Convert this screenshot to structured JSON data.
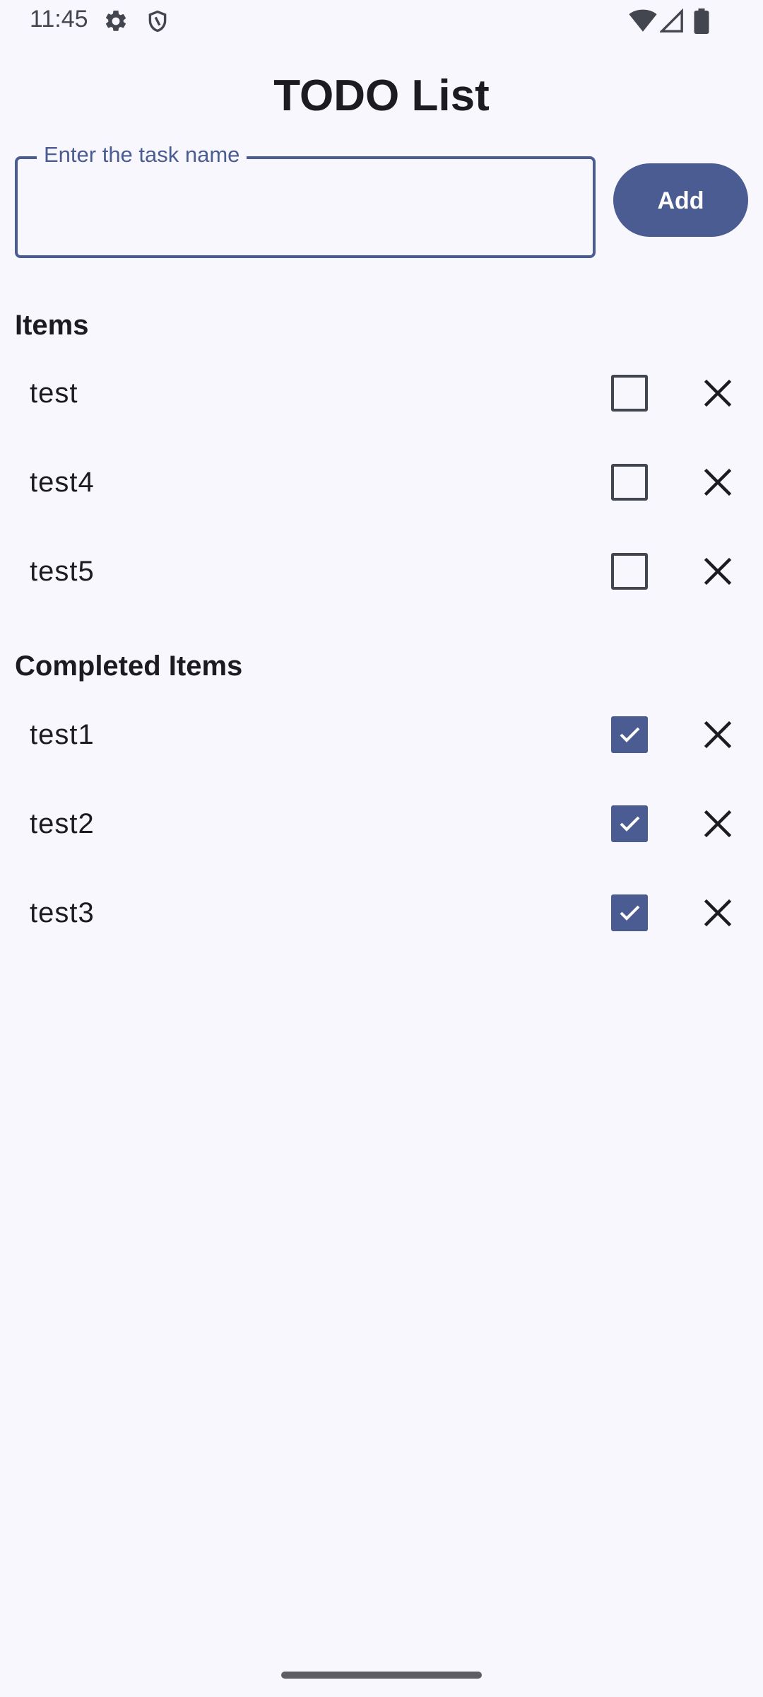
{
  "status_bar": {
    "time": "11:45",
    "icons": [
      "gear-icon",
      "shield-icon",
      "wifi-icon",
      "signal-icon",
      "battery-icon"
    ]
  },
  "app": {
    "title": "TODO List"
  },
  "input": {
    "label": "Enter the task name",
    "value": ""
  },
  "add_button": {
    "label": "Add"
  },
  "items_section": {
    "title": "Items",
    "items": [
      {
        "label": "test",
        "checked": false
      },
      {
        "label": "test4",
        "checked": false
      },
      {
        "label": "test5",
        "checked": false
      }
    ]
  },
  "completed_section": {
    "title": "Completed Items",
    "items": [
      {
        "label": "test1",
        "checked": true
      },
      {
        "label": "test2",
        "checked": true
      },
      {
        "label": "test3",
        "checked": true
      }
    ]
  },
  "colors": {
    "accent": "#4a5c92",
    "background": "#f8f7fd",
    "text": "#1b1b21"
  }
}
